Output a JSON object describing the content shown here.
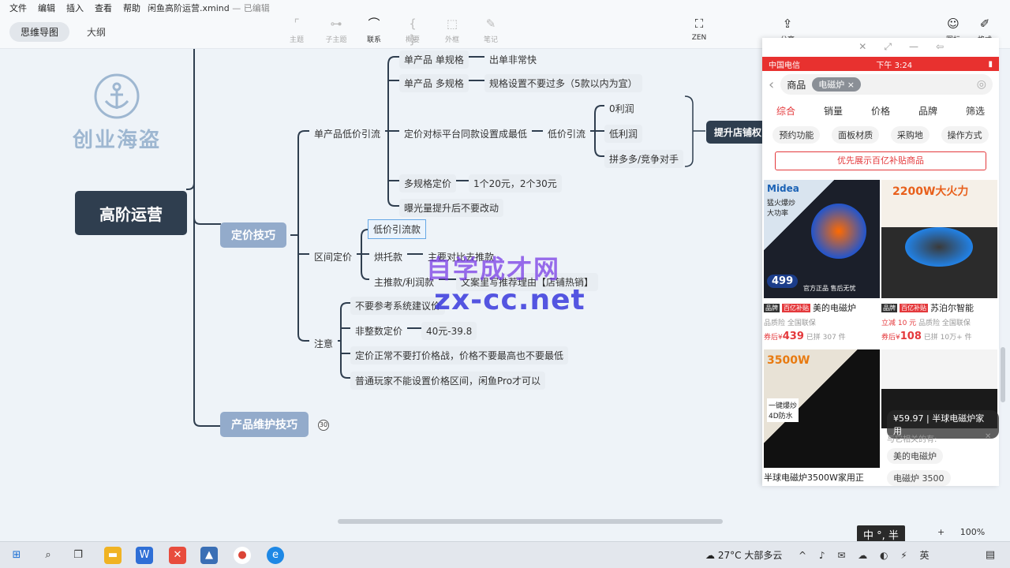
{
  "menu": [
    "文件",
    "编辑",
    "插入",
    "查看",
    "帮助"
  ],
  "file_title": "闲鱼高阶运营.xmind",
  "file_status": "— 已编辑",
  "view_tabs": [
    "思维导图",
    "大纲"
  ],
  "toolbar": {
    "topic": "主题",
    "subtopic": "子主题",
    "relation": "联系",
    "summary": "概要",
    "boundary": "外框",
    "note": "笔记",
    "zen": "ZEN",
    "share": "分享",
    "icon": "图标",
    "format": "格式"
  },
  "logo_name": "创业海盗",
  "mindmap": {
    "root": "高阶运营",
    "branch1": "定价技巧",
    "branch2": "产品维护技巧",
    "branch2_badge": "30",
    "single_low": "单产品低价引流",
    "spec_single": "单产品  单规格",
    "spec_single_note": "出单非常快",
    "spec_multi": "单产品  多规格",
    "spec_multi_note": "规格设置不要过多（5款以内为宜）",
    "platform_price": "定价对标平台同款设置成最低",
    "low_traffic": "低价引流",
    "profit_zero": "0利润",
    "profit_low": "低利润",
    "pdd": "拼多多/竞争对手",
    "boost_shop": "提升店铺权",
    "multi_spec_price": "多规格定价",
    "multi_spec_price_note": "1个20元，2个30元",
    "exposure": "曝光量提升后不要改动",
    "range_price": "区间定价",
    "low_draw": "低价引流款",
    "foil": "烘托款",
    "foil_note": "主要对比去推款",
    "main_push": "主推款/利润款",
    "main_push_note": "文案里写推荐理由【店铺热销】",
    "attention": "注意",
    "att1": "不要参考系统建议价",
    "att2": "非整数定价",
    "att2_note": "40元-39.8",
    "att3": "定价正常不要打价格战，价格不要最高也不要最低",
    "att4": "普通玩家不能设置价格区间，闲鱼Pro才可以"
  },
  "watermark": {
    "line1": "自学成才网",
    "line2": "zx-cc.net"
  },
  "phone": {
    "carrier": "中国电信",
    "time": "下午 3:24",
    "search_category": "商品",
    "search_keyword": "电磁炉",
    "sort": [
      "综合",
      "销量",
      "价格",
      "品牌",
      "筛选"
    ],
    "filters": [
      "预约功能",
      "面板材质",
      "采购地",
      "操作方式"
    ],
    "banner": "优先展示百亿补贴商品",
    "products": [
      {
        "brand_tag": "品牌",
        "subsidy_tag": "百亿补贴",
        "name": "美的电磁炉",
        "meta": "品质险  全国联保",
        "price_prefix": "券后¥",
        "price": "439",
        "sold": "已拼 307 件",
        "img_text1": "Midea",
        "img_text2": "猛火爆炒大功率",
        "img_badge": "499",
        "img_footer": "官方正品  售后无忧"
      },
      {
        "brand_tag": "品牌",
        "subsidy_tag": "百亿补贴",
        "name": "苏泊尔智能",
        "meta_red": "立减 10 元",
        "meta": "品质险  全国联保",
        "price_prefix": "券后¥",
        "price": "108",
        "sold": "已拼 10万+ 件",
        "img_text1": "2200W大火力"
      },
      {
        "name": "半球电磁炉3500W家用正",
        "img_text1": "3500W",
        "img_text2": "一键爆炒 4D防水"
      },
      {
        "price_pill": "¥59.97",
        "pill_name": "半球电磁炉家用"
      }
    ],
    "related_label": "与它相关的有:",
    "related": [
      "美的电磁炉",
      "电磁炉 3500"
    ]
  },
  "status": {
    "ime": "中 °, 半",
    "zoom": "100%"
  },
  "taskbar": {
    "temp": "27°C",
    "weather": "大部多云"
  },
  "colors": {
    "root": "#2f3e4f",
    "branch": "#93abcb",
    "accent": "#e4393c",
    "line": "#2f3e4f"
  }
}
